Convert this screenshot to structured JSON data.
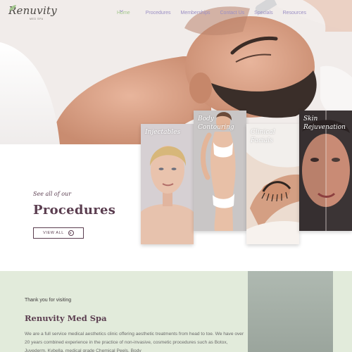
{
  "brand": {
    "logo_text": "Renuvity",
    "logo_subtext": "MED SPA",
    "accent_green": "#a3c78e",
    "accent_purple": "#9b8fc4",
    "heading_plum": "#5b3e50"
  },
  "nav": {
    "items": [
      {
        "label": "Home",
        "active": true
      },
      {
        "label": "Procedures",
        "has_dropdown": true
      },
      {
        "label": "Memberships"
      },
      {
        "label": "Contact Us"
      },
      {
        "label": "Specials"
      },
      {
        "label": "Resources"
      }
    ],
    "icon": "chevron-down-icon"
  },
  "procedures": {
    "kicker": "See all of our",
    "title": "Procedures",
    "button_label": "VIEW ALL",
    "button_icon": "arrow-circle-icon",
    "cards": [
      {
        "line1": "Injectables",
        "line2": ""
      },
      {
        "line1": "Body",
        "line2": "Contouring"
      },
      {
        "line1": "Clinical",
        "line2": "Facials"
      },
      {
        "line1": "Skin",
        "line2": "Rejuvenation"
      }
    ]
  },
  "intro": {
    "kicker": "Thank you for visiting",
    "title": "Renuvity Med Spa",
    "paragraph": "We are a full service medical aesthetics clinic offering aesthetic treatments from head to toe. We have over 20 years combined experience in the practice of non-invasive, cosmetic procedures such as Botox, Juvederm, Kybella, medical grade Chemical Peels, Body"
  }
}
